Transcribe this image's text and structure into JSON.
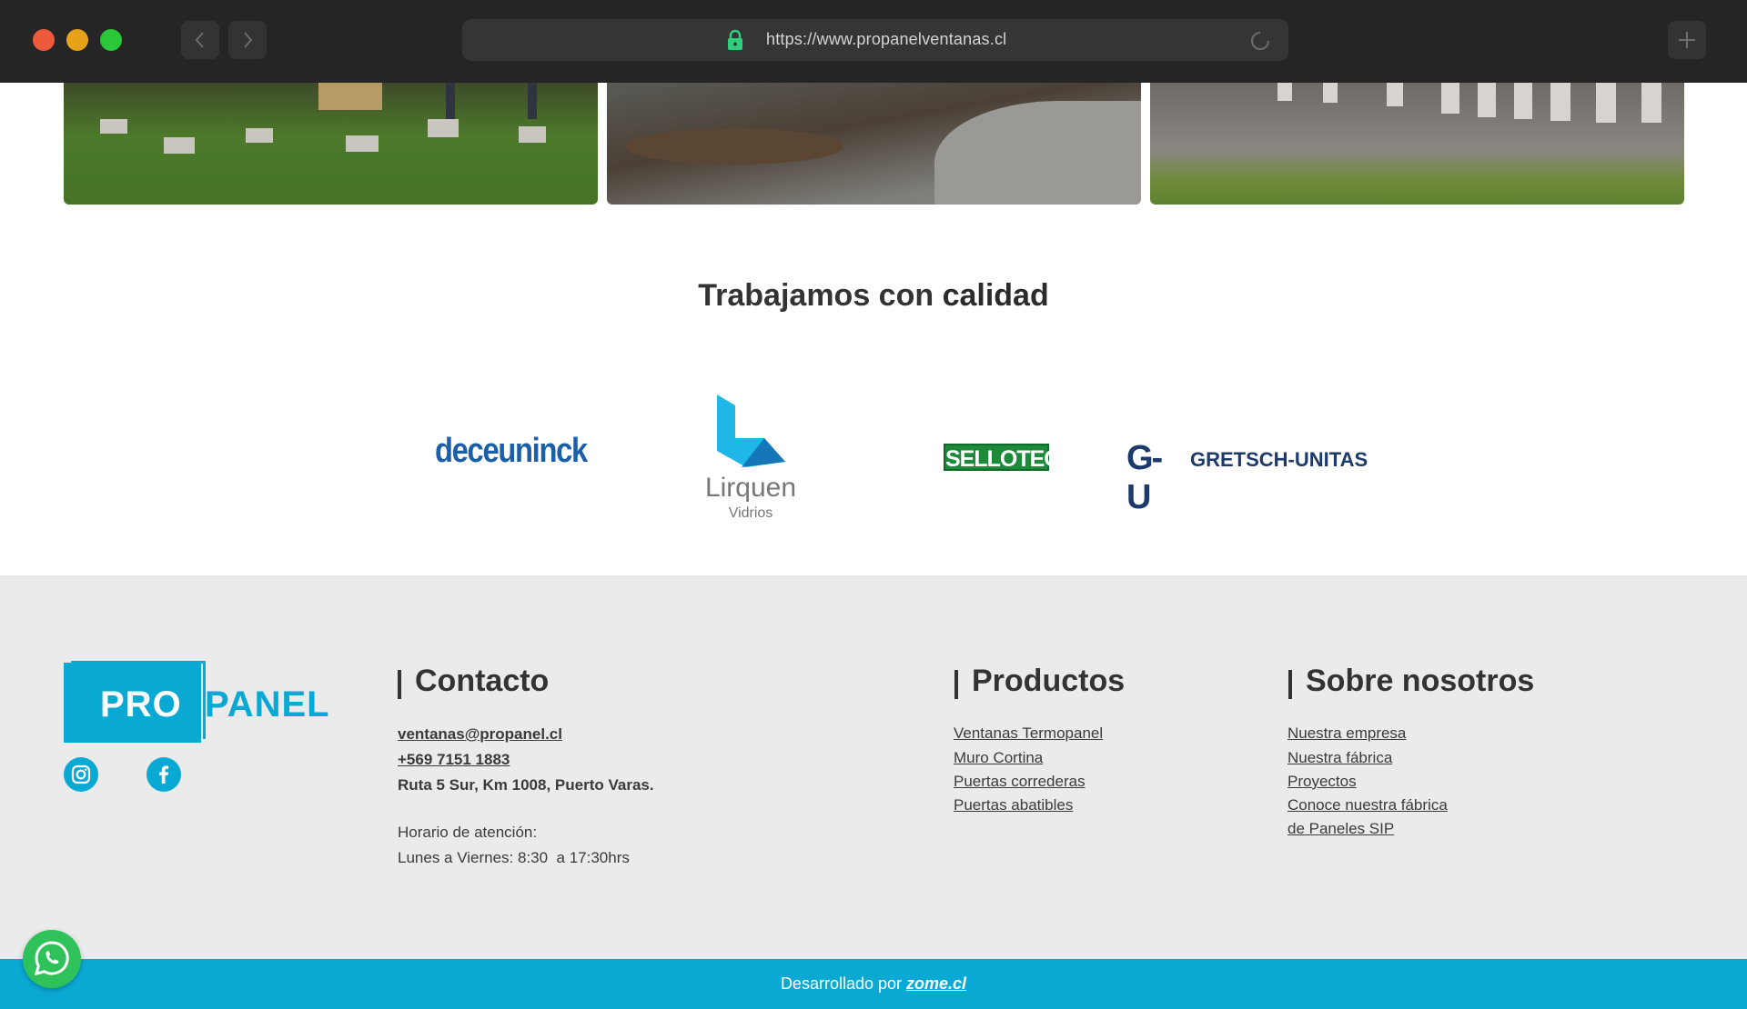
{
  "browser": {
    "url": "https://www.propanelventanas.cl",
    "back_icon": "chevron-left-icon",
    "forward_icon": "chevron-right-icon",
    "new_tab_icon": "plus-icon"
  },
  "quality": {
    "title_light": "Trabajamos con ",
    "title_bold": "calidad",
    "partners": {
      "deceuninck": "deceuninck",
      "lirquen": "Lirquen",
      "lirquen_sub": "Vidrios",
      "sellotec": "SELLOTEC",
      "gu_mark": "G-U",
      "gu_name": "GRETSCH-UNITAS"
    }
  },
  "footer": {
    "brand_pro": "PRO",
    "brand_panel": "PANEL",
    "contact": {
      "heading": "Contacto",
      "email": "ventanas@propanel.cl",
      "phone": "+569 7151 1883",
      "address": "Ruta 5 Sur, Km 1008, Puerto Varas.",
      "hours_label": "Horario de atención:",
      "hours": "Lunes a Viernes: 8:30  a 17:30hrs"
    },
    "products": {
      "heading": "Productos",
      "items": [
        "Ventanas Termopanel",
        "Muro Cortina",
        "Puertas correderas",
        "Puertas abatibles"
      ]
    },
    "about": {
      "heading": "Sobre nosotros",
      "items": [
        "Nuestra empresa",
        "Nuestra fábrica",
        "Proyectos",
        "Conoce nuestra fábrica",
        "de Paneles SIP"
      ]
    },
    "credit_prefix": "Desarrollado por ",
    "credit_link": "zome.cl"
  },
  "colors": {
    "accent": "#0aa9d4",
    "footer_bg": "#ebebeb",
    "whatsapp": "#2fc25b"
  }
}
